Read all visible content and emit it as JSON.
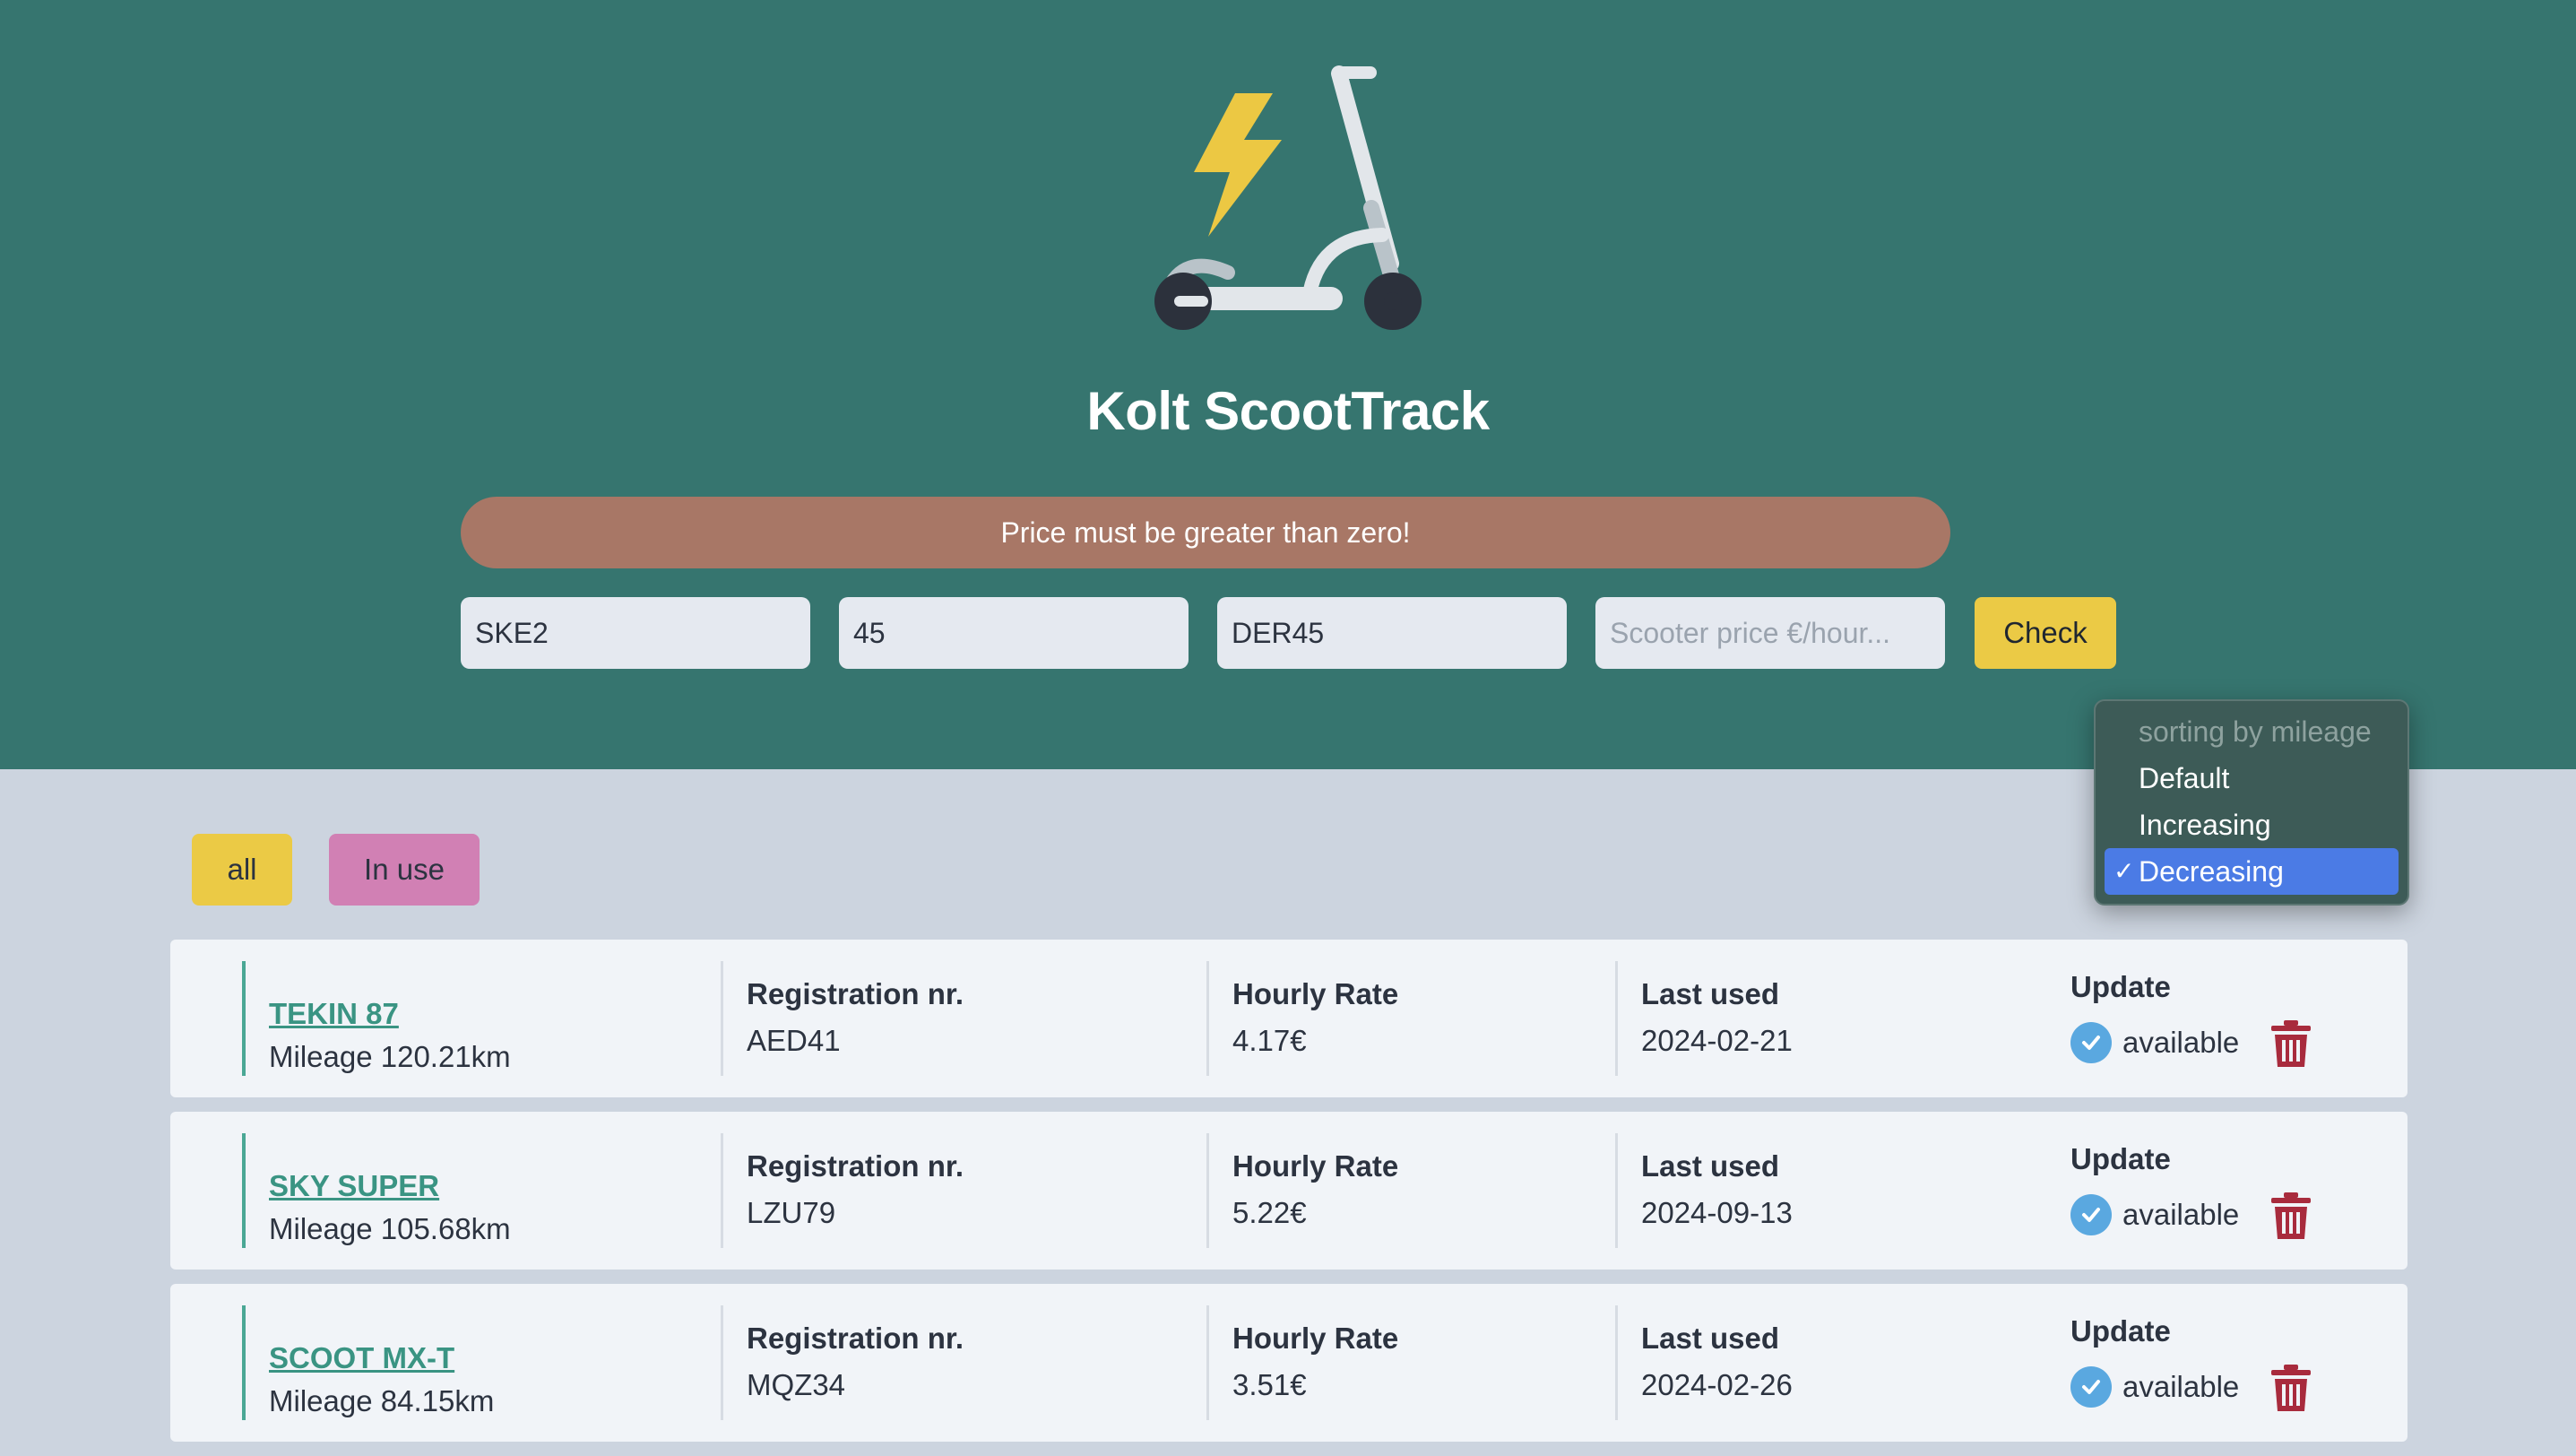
{
  "app": {
    "title": "Kolt ScootTrack"
  },
  "colors": {
    "header_bg": "#36756f",
    "accent_yellow": "#ebca45",
    "accent_pink": "#d180b4",
    "error_bg": "#a87766",
    "link": "#3a9483"
  },
  "error": {
    "message": "Price must be greater than zero!"
  },
  "form": {
    "name_value": "SKE2",
    "mileage_value": "45",
    "registration_value": "DER45",
    "price_placeholder": "Scooter price €/hour...",
    "price_value": "",
    "check_label": "Check"
  },
  "sort": {
    "options": [
      {
        "label": "sorting by mileage",
        "disabled": true
      },
      {
        "label": "Default"
      },
      {
        "label": "Increasing"
      },
      {
        "label": "Decreasing",
        "selected": true
      }
    ],
    "tick": "✓"
  },
  "filters": {
    "all_label": "all",
    "in_use_label": "In use"
  },
  "columns": {
    "registration": "Registration nr.",
    "hourly_rate": "Hourly Rate",
    "last_used": "Last used",
    "update": "Update"
  },
  "scooters": [
    {
      "name": "TEKIN 87",
      "mileage": "Mileage 120.21km",
      "registration": "AED41",
      "rate": "4.17€",
      "last_used": "2024-02-21",
      "status": "available"
    },
    {
      "name": "SKY SUPER",
      "mileage": "Mileage 105.68km",
      "registration": "LZU79",
      "rate": "5.22€",
      "last_used": "2024-09-13",
      "status": "available"
    },
    {
      "name": "SCOOT MX-T",
      "mileage": "Mileage 84.15km",
      "registration": "MQZ34",
      "rate": "3.51€",
      "last_used": "2024-02-26",
      "status": "available"
    }
  ]
}
